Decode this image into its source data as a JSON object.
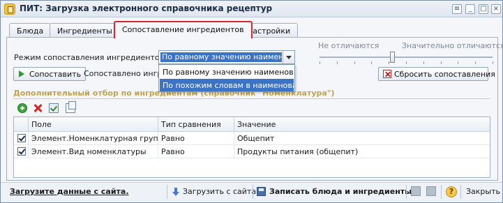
{
  "window": {
    "title": "ПИТ: Загрузка электронного справочника рецептур"
  },
  "tabs": [
    {
      "label": "Блюда"
    },
    {
      "label": "Ингредиенты"
    },
    {
      "label": "Сопоставление ингредиентов"
    },
    {
      "label": "Настройки"
    }
  ],
  "mode": {
    "label": "Режим сопоставления ингредиентов:",
    "selected": "По равному значению наименования",
    "options": [
      "По равному значению наименования",
      "По похожим словам в наименовании"
    ]
  },
  "slider": {
    "left_label": "Не отличаются",
    "right_label": "Значительно отличаются",
    "value": 0.42
  },
  "actions": {
    "match_label": "Сопоставить",
    "matched_text": "Сопоставлено ингре",
    "reset_label": "Сбросить сопоставления"
  },
  "filter": {
    "title": "Дополнительный отбор по ингредиентам (справочник \"Номенклатура\")",
    "toolbar_icons": [
      "add-icon",
      "delete-icon",
      "check-all-icon",
      "copy-icon"
    ],
    "columns": [
      "Поле",
      "Тип сравнения",
      "Значение"
    ],
    "rows": [
      {
        "checked": true,
        "field": "Элемент.Номенклатурная группа",
        "compare": "Равно",
        "value": "Общепит"
      },
      {
        "checked": true,
        "field": "Элемент.Вид номенклатуры",
        "compare": "Равно",
        "value": "Продукты питания (общепит)"
      }
    ]
  },
  "bottom": {
    "link": "Загрузите данные с сайта.",
    "load_label": "Загрузить с сайта",
    "save_label": "Записать блюда и ингредиенты",
    "close_label": "Закрыть",
    "help_glyph": "?"
  },
  "colors": {
    "active_tab_border": "#d82a2a",
    "selection": "#3b73c6",
    "section_title": "#c2a34b"
  }
}
